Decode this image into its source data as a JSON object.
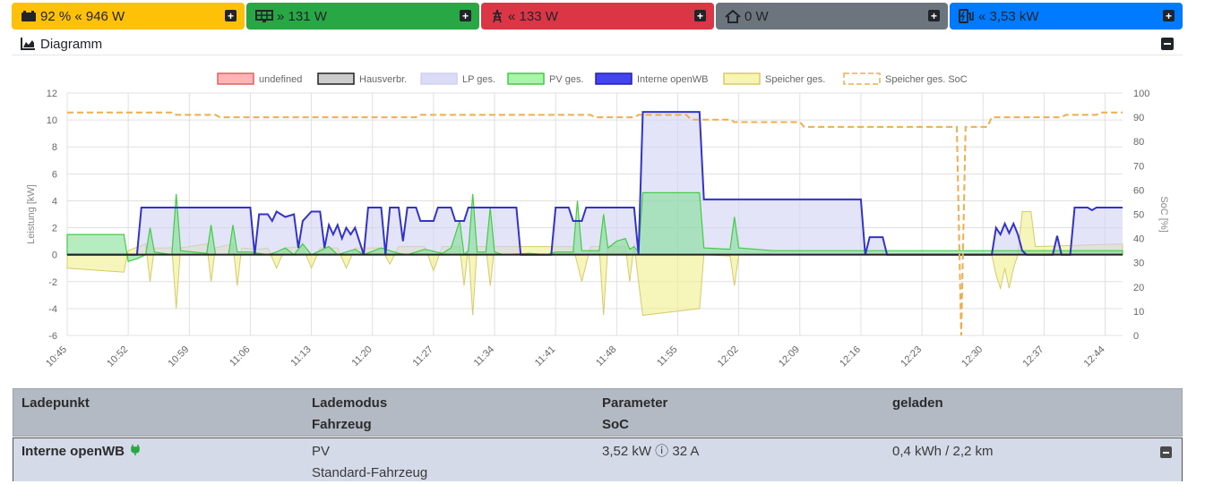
{
  "tiles": {
    "battery": {
      "text": "92 % « 946 W",
      "icon": "battery-car-icon",
      "color": "#ffc107"
    },
    "pv": {
      "text": "» 131 W",
      "icon": "solar-panel-icon",
      "color": "#28a745"
    },
    "grid": {
      "text": "« 133 W",
      "icon": "power-tower-icon",
      "color": "#dc3545"
    },
    "house": {
      "text": "0 W",
      "icon": "house-icon",
      "color": "#6c757d"
    },
    "charge": {
      "text": "« 3,53 kW",
      "icon": "charging-station-icon",
      "color": "#007bff"
    }
  },
  "diagram": {
    "title": "Diagramm"
  },
  "chart_data": {
    "type": "line",
    "legend": [
      "undefined",
      "Hausverbr.",
      "LP ges.",
      "PV ges.",
      "Interne openWB",
      "Speicher ges.",
      "Speicher ges. SoC"
    ],
    "ylabel": "Leistung [kW]",
    "y2label": "SoC [%]",
    "ylim": [
      -6,
      12
    ],
    "y2lim": [
      0,
      100
    ],
    "yticks": [
      "12",
      "10",
      "8",
      "6",
      "4",
      "2",
      "0",
      "-2",
      "-4",
      "-6"
    ],
    "y2ticks": [
      "100",
      "90",
      "80",
      "70",
      "60",
      "50",
      "40",
      "30",
      "20",
      "10",
      "0"
    ],
    "xticks": [
      "10:45",
      "10:52",
      "10:59",
      "11:06",
      "11:13",
      "11:20",
      "11:27",
      "11:34",
      "11:41",
      "11:48",
      "11:55",
      "12:02",
      "12:09",
      "12:16",
      "12:23",
      "12:30",
      "12:37",
      "12:44"
    ],
    "x_minutes": [
      0,
      121
    ],
    "series": [
      {
        "name": "Interne openWB",
        "color": "#3333cc",
        "points": [
          [
            0,
            0
          ],
          [
            8,
            0
          ],
          [
            8.5,
            3.5
          ],
          [
            21,
            3.5
          ],
          [
            21.5,
            0
          ],
          [
            22,
            3
          ],
          [
            23,
            3
          ],
          [
            23.5,
            2.5
          ],
          [
            24,
            3.2
          ],
          [
            25,
            2.8
          ],
          [
            26,
            3
          ],
          [
            26.5,
            0.5
          ],
          [
            27,
            2.5
          ],
          [
            28,
            3.2
          ],
          [
            29,
            3.2
          ],
          [
            29.5,
            0.5
          ],
          [
            30,
            2.2
          ],
          [
            30.5,
            1.5
          ],
          [
            31,
            2.2
          ],
          [
            31.5,
            1.2
          ],
          [
            32,
            2
          ],
          [
            32.5,
            1.5
          ],
          [
            33,
            2
          ],
          [
            34,
            0
          ],
          [
            34.5,
            3.5
          ],
          [
            36,
            3.5
          ],
          [
            36.5,
            0
          ],
          [
            37,
            3.5
          ],
          [
            38,
            3.5
          ],
          [
            38.5,
            1
          ],
          [
            39,
            3.5
          ],
          [
            40,
            3.5
          ],
          [
            40.5,
            2.5
          ],
          [
            42,
            2.5
          ],
          [
            42.5,
            3.5
          ],
          [
            44,
            3.5
          ],
          [
            44.5,
            2.5
          ],
          [
            45.5,
            2.5
          ],
          [
            46,
            3.5
          ],
          [
            51.5,
            3.5
          ],
          [
            52,
            0
          ],
          [
            55.5,
            0
          ],
          [
            56,
            3.5
          ],
          [
            57.5,
            3.5
          ],
          [
            58,
            2.5
          ],
          [
            59,
            2.5
          ],
          [
            59.5,
            3.5
          ],
          [
            65,
            3.5
          ],
          [
            65.5,
            0
          ],
          [
            66,
            10.6
          ],
          [
            72.5,
            10.6
          ],
          [
            73,
            4.1
          ],
          [
            91,
            4.1
          ],
          [
            91.5,
            0
          ],
          [
            92,
            1.3
          ],
          [
            93.5,
            1.3
          ],
          [
            94,
            0
          ],
          [
            106,
            0
          ],
          [
            106.5,
            2
          ],
          [
            107,
            1.5
          ],
          [
            107.5,
            2.3
          ],
          [
            108,
            1.6
          ],
          [
            108.5,
            2.3
          ],
          [
            109,
            1.5
          ],
          [
            109.5,
            0.3
          ],
          [
            110,
            0
          ],
          [
            113,
            0
          ],
          [
            113.5,
            1.4
          ],
          [
            114,
            0
          ],
          [
            115,
            0
          ],
          [
            115.5,
            3.5
          ],
          [
            117,
            3.5
          ],
          [
            117.5,
            3.3
          ],
          [
            118,
            3.5
          ],
          [
            121,
            3.5
          ]
        ]
      },
      {
        "name": "PV ges.",
        "color": "#33cc33",
        "points": [
          [
            0,
            1.5
          ],
          [
            6.5,
            1.5
          ],
          [
            7,
            -0.5
          ],
          [
            8,
            -0.3
          ],
          [
            9,
            0
          ],
          [
            9.5,
            2
          ],
          [
            10,
            0.2
          ],
          [
            12,
            0
          ],
          [
            12.5,
            4.5
          ],
          [
            13,
            0.3
          ],
          [
            16,
            0.1
          ],
          [
            16.5,
            2.2
          ],
          [
            17,
            0
          ],
          [
            18.5,
            0
          ],
          [
            19,
            2.2
          ],
          [
            19.5,
            0.2
          ],
          [
            21,
            0.2
          ],
          [
            22,
            0.1
          ],
          [
            23,
            0
          ],
          [
            24,
            0.2
          ],
          [
            25,
            0.5
          ],
          [
            26,
            0
          ],
          [
            27,
            0.8
          ],
          [
            28,
            0
          ],
          [
            30,
            0.6
          ],
          [
            31,
            0
          ],
          [
            33,
            0.4
          ],
          [
            34,
            0
          ],
          [
            36,
            0.5
          ],
          [
            38,
            0.1
          ],
          [
            39,
            0
          ],
          [
            41,
            0.4
          ],
          [
            43,
            0.1
          ],
          [
            44,
            0.5
          ],
          [
            45,
            2.5
          ],
          [
            45.5,
            0
          ],
          [
            46,
            0.3
          ],
          [
            46.5,
            4.5
          ],
          [
            47,
            0.2
          ],
          [
            48,
            0.2
          ],
          [
            48.5,
            3.5
          ],
          [
            49,
            0.2
          ],
          [
            50,
            0
          ],
          [
            53,
            0.1
          ],
          [
            55,
            0
          ],
          [
            56,
            0.2
          ],
          [
            58,
            0.2
          ],
          [
            58.5,
            4
          ],
          [
            59,
            0.3
          ],
          [
            61,
            0.3
          ],
          [
            61.5,
            3
          ],
          [
            62,
            0.5
          ],
          [
            63,
            1
          ],
          [
            64,
            1.2
          ],
          [
            64.5,
            0.4
          ],
          [
            65,
            0.6
          ],
          [
            65.5,
            0.2
          ],
          [
            66,
            4.6
          ],
          [
            72.5,
            4.6
          ],
          [
            73,
            0.5
          ],
          [
            76,
            0.4
          ],
          [
            76.5,
            2.8
          ],
          [
            77,
            0.5
          ],
          [
            81,
            0.3
          ],
          [
            121,
            0.3
          ]
        ]
      },
      {
        "name": "Speicher ges.",
        "color": "#d4d46a",
        "points": [
          [
            0,
            -1
          ],
          [
            6.5,
            -1.3
          ],
          [
            7,
            0.3
          ],
          [
            9,
            0.8
          ],
          [
            9.5,
            -2
          ],
          [
            10,
            0.5
          ],
          [
            12,
            0.5
          ],
          [
            12.5,
            -4
          ],
          [
            13,
            0.5
          ],
          [
            16,
            0.8
          ],
          [
            16.5,
            -2
          ],
          [
            17,
            0.5
          ],
          [
            19,
            0.8
          ],
          [
            19.5,
            -2.3
          ],
          [
            20,
            0.5
          ],
          [
            22,
            0.4
          ],
          [
            23,
            0.5
          ],
          [
            24,
            -1
          ],
          [
            25,
            0.5
          ],
          [
            27,
            0.6
          ],
          [
            28,
            -1
          ],
          [
            29,
            0.5
          ],
          [
            31,
            0.5
          ],
          [
            32,
            -1
          ],
          [
            33,
            0.5
          ],
          [
            36,
            0.5
          ],
          [
            37,
            -0.7
          ],
          [
            38,
            0.6
          ],
          [
            41,
            0.6
          ],
          [
            42,
            -1.2
          ],
          [
            43,
            0.6
          ],
          [
            45,
            0.6
          ],
          [
            45.5,
            -2.3
          ],
          [
            46,
            0.6
          ],
          [
            46.5,
            -4.5
          ],
          [
            47,
            0.6
          ],
          [
            48,
            0.6
          ],
          [
            48.5,
            -2.3
          ],
          [
            49,
            0.6
          ],
          [
            52,
            0.6
          ],
          [
            53,
            0.6
          ],
          [
            56,
            0.6
          ],
          [
            58,
            0.6
          ],
          [
            59,
            -2
          ],
          [
            60,
            0.6
          ],
          [
            61,
            0.6
          ],
          [
            61.5,
            -4.5
          ],
          [
            62,
            0.6
          ],
          [
            64,
            0.6
          ],
          [
            64.5,
            -2
          ],
          [
            65,
            0.8
          ],
          [
            65.5,
            -2
          ],
          [
            66,
            -4.5
          ],
          [
            72.5,
            -4
          ],
          [
            73,
            0
          ],
          [
            76,
            -0.1
          ],
          [
            76.5,
            -2.3
          ],
          [
            77,
            0
          ],
          [
            106,
            0
          ],
          [
            106.5,
            -1.5
          ],
          [
            107,
            -2.5
          ],
          [
            107.5,
            -1
          ],
          [
            108,
            -2.5
          ],
          [
            108.5,
            -1
          ],
          [
            109,
            0
          ],
          [
            109.5,
            3.2
          ],
          [
            110.5,
            3.2
          ],
          [
            111,
            0.6
          ],
          [
            121,
            0.8
          ]
        ]
      },
      {
        "name": "Speicher ges. SoC",
        "color": "#f0ad4e",
        "points": [
          [
            0,
            92
          ],
          [
            12,
            92
          ],
          [
            12.5,
            91
          ],
          [
            17,
            91
          ],
          [
            17.5,
            90
          ],
          [
            40,
            90
          ],
          [
            40.5,
            91
          ],
          [
            60,
            91
          ],
          [
            60.5,
            90
          ],
          [
            65,
            90
          ],
          [
            65.5,
            91
          ],
          [
            71,
            91
          ],
          [
            71.5,
            89
          ],
          [
            76,
            89
          ],
          [
            76.5,
            88
          ],
          [
            84,
            88
          ],
          [
            84.5,
            86
          ],
          [
            102,
            86
          ],
          [
            102.5,
            0
          ],
          [
            103,
            86
          ],
          [
            104,
            86
          ],
          [
            105.5,
            86
          ],
          [
            106,
            90
          ],
          [
            114,
            90
          ],
          [
            114.5,
            91
          ],
          [
            118,
            91
          ],
          [
            118.5,
            92
          ],
          [
            121,
            92
          ]
        ]
      }
    ]
  },
  "table": {
    "headers": {
      "c1": "Ladepunkt",
      "c2a": "Lademodus",
      "c2b": "Fahrzeug",
      "c3a": "Parameter",
      "c3b": "SoC",
      "c4": "geladen"
    },
    "row": {
      "name": "Interne openWB",
      "mode": "PV",
      "vehicle": "Standard-Fahrzeug",
      "param": "3,52 kW ⓘ 32 A",
      "charged": "0,4 kWh / 2,2 km"
    }
  }
}
